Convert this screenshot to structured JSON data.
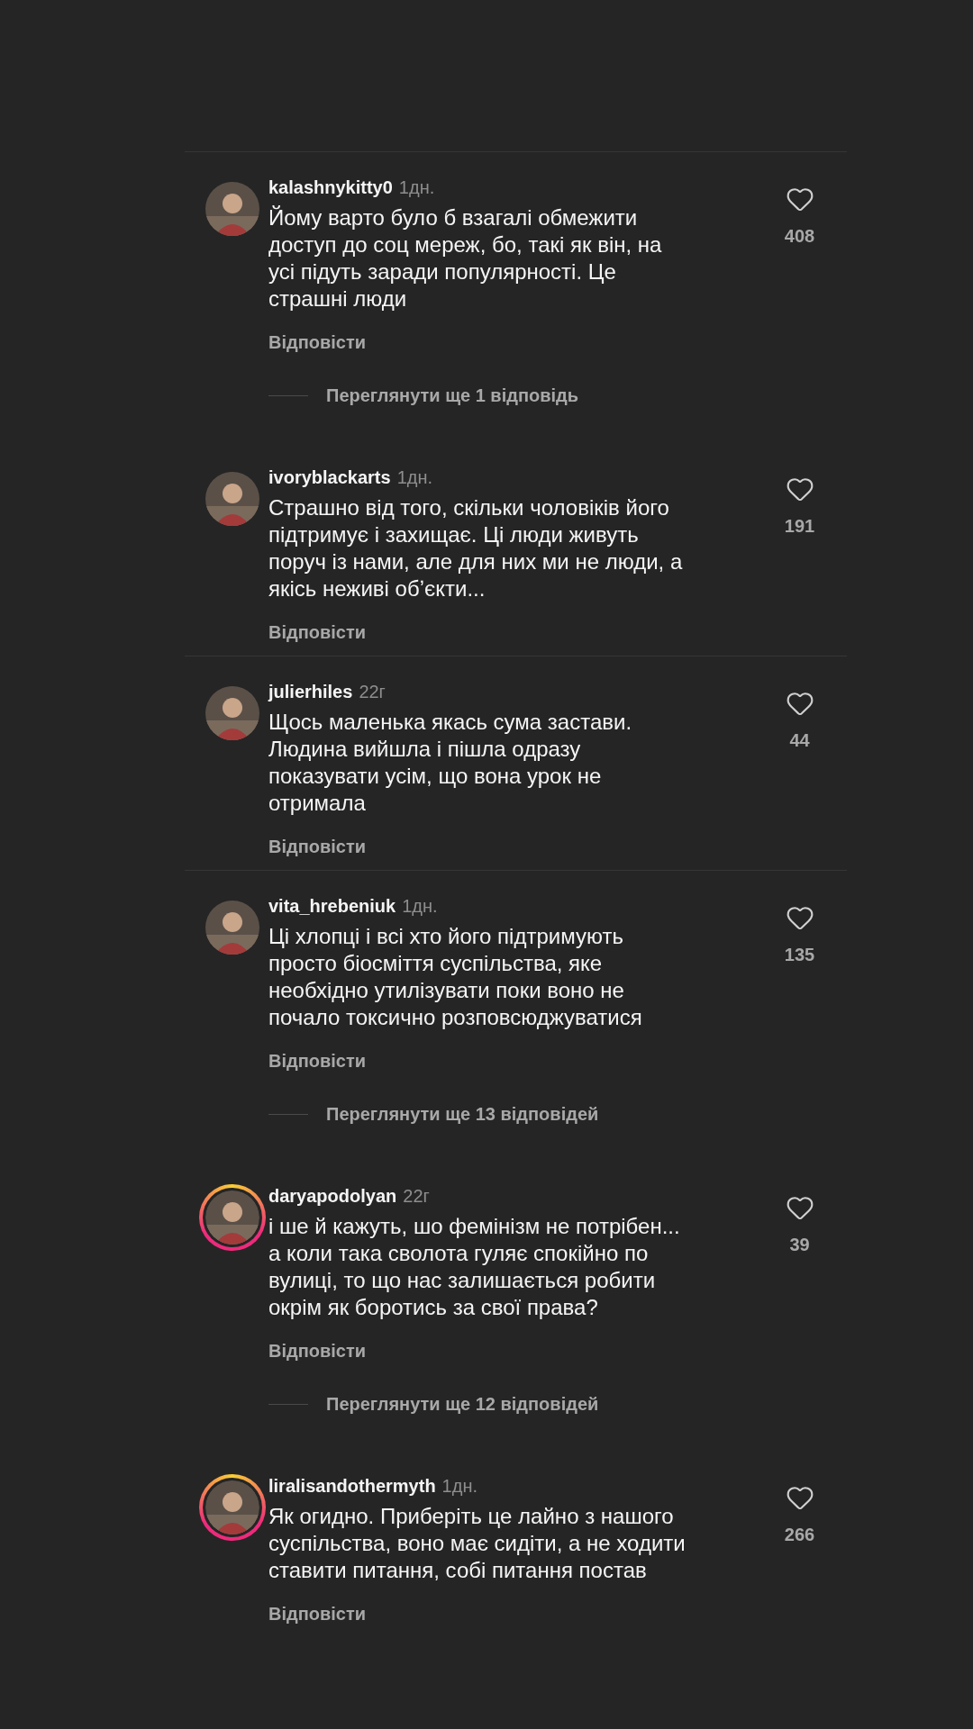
{
  "comments": [
    {
      "username": "kalashnykitty0",
      "time": "1дн.",
      "lines": [
        "Йому варто було б взагалі обмежити",
        "доступ до соц мереж, бо, такі як він, на",
        "усі підуть заради популярності. Це",
        "страшні люди"
      ],
      "likes": "408",
      "reply": "Відповісти",
      "view_replies": "Переглянути ще 1 відповідь",
      "story_ring": false,
      "divider_above": true
    },
    {
      "username": "ivoryblackarts",
      "time": "1дн.",
      "lines": [
        "Страшно від того, скільки чоловіків його",
        "підтримує і захищає. Ці люди живуть",
        "поруч із нами, але для них ми не люди, а",
        "якісь неживі обʼєкти..."
      ],
      "likes": "191",
      "reply": "Відповісти",
      "story_ring": false,
      "divider_above": false
    },
    {
      "username": "julierhiles",
      "time": "22г",
      "lines": [
        "Щось маленька якась сума застави.",
        "Людина вийшла і пішла одразу",
        "показувати усім, що вона урок не",
        "отримала"
      ],
      "likes": "44",
      "reply": "Відповісти",
      "story_ring": false,
      "divider_above": true
    },
    {
      "username": "vita_hrebeniuk",
      "time": "1дн.",
      "lines": [
        "Ці хлопці і всі хто його підтримують",
        "просто біосміття суспільства, яке",
        "необхідно утилізувати поки воно не",
        "почало токсично розповсюджуватися"
      ],
      "likes": "135",
      "reply": "Відповісти",
      "view_replies": "Переглянути ще 13 відповідей",
      "story_ring": false,
      "divider_above": true
    },
    {
      "username": "daryapodolyan",
      "time": "22г",
      "lines": [
        "і ше й кажуть, шо фемінізм не потрібен...",
        "а коли така сволота гуляє спокійно по",
        "вулиці, то що нас залишається робити",
        "окрім як боротись за свої права?"
      ],
      "likes": "39",
      "reply": "Відповісти",
      "view_replies": "Переглянути ще 12 відповідей",
      "story_ring": true,
      "divider_above": false
    },
    {
      "username": "liralisandothermyth",
      "time": "1дн.",
      "lines": [
        "Як огидно. Приберіть це лайно з нашого",
        "суспільства, воно має сидіти, а не ходити",
        "ставити питання, собі питання постав"
      ],
      "likes": "266",
      "reply": "Відповісти",
      "story_ring": true,
      "divider_above": false
    }
  ]
}
